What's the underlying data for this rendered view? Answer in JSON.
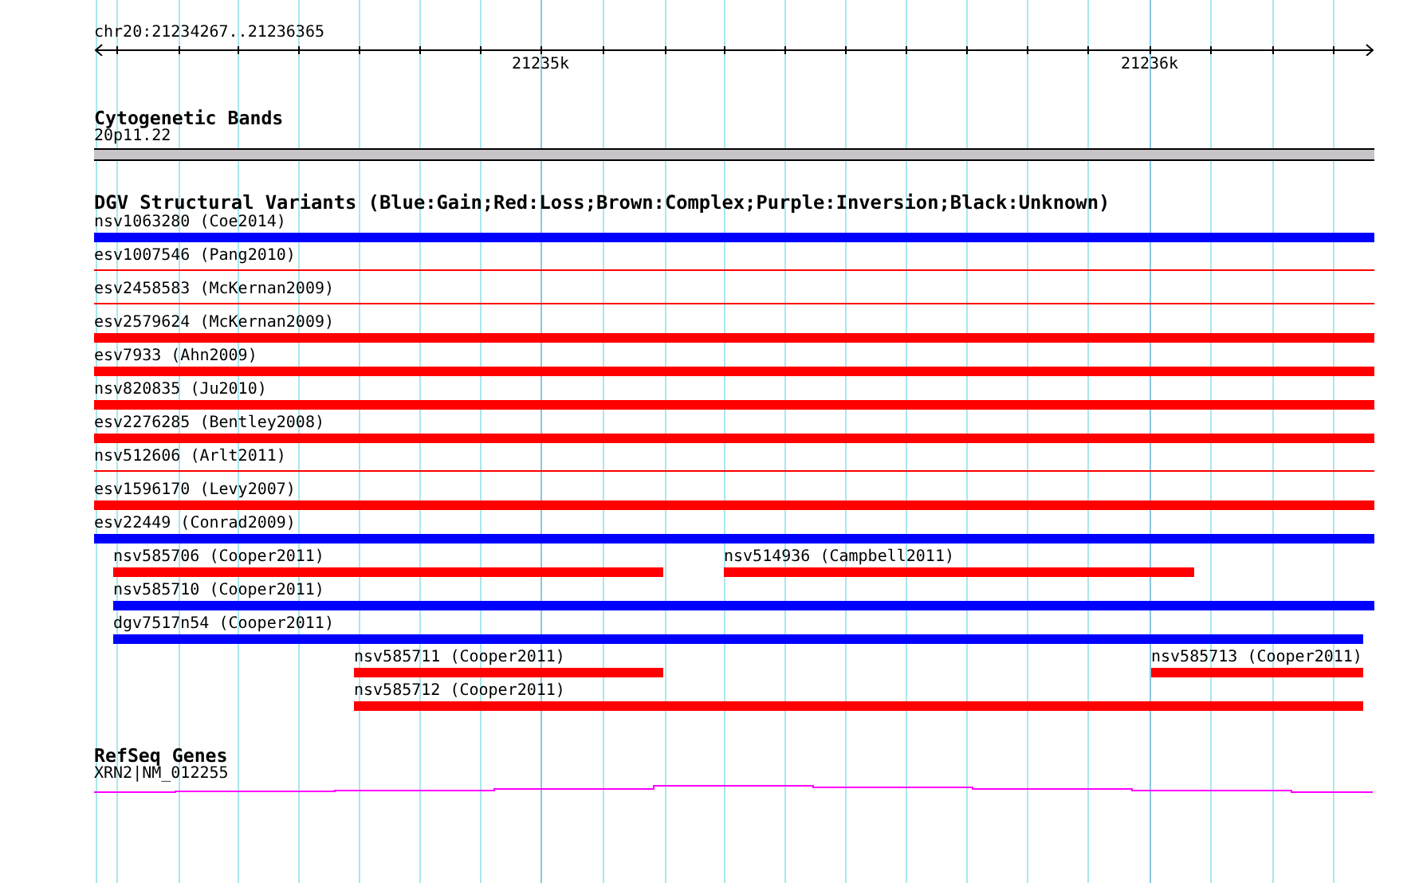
{
  "ruler": {
    "region": "chr20:21234267..21236365",
    "tick_labels": [
      "21235k",
      "21236k"
    ]
  },
  "cytogenetic_bands": {
    "title": "Cytogenetic Bands",
    "band": "20p11.22"
  },
  "dgv_structural_variants": {
    "title": "DGV Structural Variants (Blue:Gain;Red:Loss;Brown:Complex;Purple:Inversion;Black:Unknown)",
    "rows": [
      {
        "features": [
          {
            "label": "nsv1063280 (Coe2014)",
            "color": "#0000ff",
            "kind": "bar"
          }
        ]
      },
      {
        "features": [
          {
            "label": "esv1007546 (Pang2010)",
            "color": "#ff0000",
            "kind": "line"
          }
        ]
      },
      {
        "features": [
          {
            "label": "esv2458583 (McKernan2009)",
            "color": "#ff0000",
            "kind": "line"
          }
        ]
      },
      {
        "features": [
          {
            "label": "esv2579624 (McKernan2009)",
            "color": "#ff0000",
            "kind": "bar"
          }
        ]
      },
      {
        "features": [
          {
            "label": "esv7933 (Ahn2009)",
            "color": "#ff0000",
            "kind": "bar"
          }
        ]
      },
      {
        "features": [
          {
            "label": "nsv820835 (Ju2010)",
            "color": "#ff0000",
            "kind": "bar"
          }
        ]
      },
      {
        "features": [
          {
            "label": "esv2276285 (Bentley2008)",
            "color": "#ff0000",
            "kind": "bar"
          }
        ]
      },
      {
        "features": [
          {
            "label": "nsv512606 (Arlt2011)",
            "color": "#ff0000",
            "kind": "line"
          }
        ]
      },
      {
        "features": [
          {
            "label": "esv1596170 (Levy2007)",
            "color": "#ff0000",
            "kind": "bar"
          }
        ]
      },
      {
        "features": [
          {
            "label": "esv22449 (Conrad2009)",
            "color": "#0000ff",
            "kind": "bar"
          }
        ]
      },
      {
        "features": [
          {
            "label": "nsv585706 (Cooper2011)",
            "color": "#ff0000",
            "kind": "bar"
          },
          {
            "label": "nsv514936 (Campbell2011)",
            "color": "#ff0000",
            "kind": "bar"
          }
        ]
      },
      {
        "features": [
          {
            "label": "nsv585710 (Cooper2011)",
            "color": "#0000ff",
            "kind": "bar"
          }
        ]
      },
      {
        "features": [
          {
            "label": "dgv7517n54 (Cooper2011)",
            "color": "#0000ff",
            "kind": "bar"
          }
        ]
      },
      {
        "features": [
          {
            "label": "nsv585711 (Cooper2011)",
            "color": "#ff0000",
            "kind": "bar"
          },
          {
            "label": "nsv585713 (Cooper2011)",
            "color": "#ff0000",
            "kind": "bar"
          }
        ]
      },
      {
        "features": [
          {
            "label": "nsv585712 (Cooper2011)",
            "color": "#ff0000",
            "kind": "bar"
          }
        ]
      }
    ]
  },
  "refseq_genes": {
    "title": "RefSeq Genes",
    "gene": "XRN2|NM_012255"
  }
}
